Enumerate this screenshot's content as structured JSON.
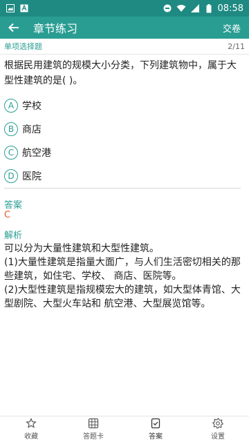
{
  "status_bar": {
    "time": "08:58"
  },
  "app_bar": {
    "title": "章节练习",
    "submit_label": "交卷"
  },
  "question": {
    "type": "单项选择题",
    "progress": "2/11",
    "text": "根据民用建筑的规模大小分类，下列建筑物中，属于大型性建筑的是(    )。",
    "options": [
      {
        "letter": "A",
        "text": "学校"
      },
      {
        "letter": "B",
        "text": "商店"
      },
      {
        "letter": "C",
        "text": "航空港"
      },
      {
        "letter": "D",
        "text": "医院"
      }
    ]
  },
  "answer": {
    "title": "答案",
    "value": "C"
  },
  "analysis": {
    "title": "解析",
    "lines": [
      "可以分为大量性建筑和大型性建筑。",
      "(1)大量性建筑是指量大面广，与人们生活密切相关的那些建筑，如住宅、学校、 商店、医院等。",
      "(2)大型性建筑是指规模宏大的建筑，如大型体青馆、大型剧院、大型火车站和 航空港、大型展览馆等。"
    ]
  },
  "bottom_nav": {
    "items": [
      {
        "label": "收藏",
        "icon": "star-icon"
      },
      {
        "label": "答题卡",
        "icon": "grid-icon"
      },
      {
        "label": "答案",
        "icon": "answer-icon"
      },
      {
        "label": "设置",
        "icon": "gear-icon"
      }
    ],
    "active": "答案"
  },
  "colors": {
    "primary": "#2a9d93",
    "status_bar": "#1e8a82",
    "answer": "#e05b2b"
  }
}
